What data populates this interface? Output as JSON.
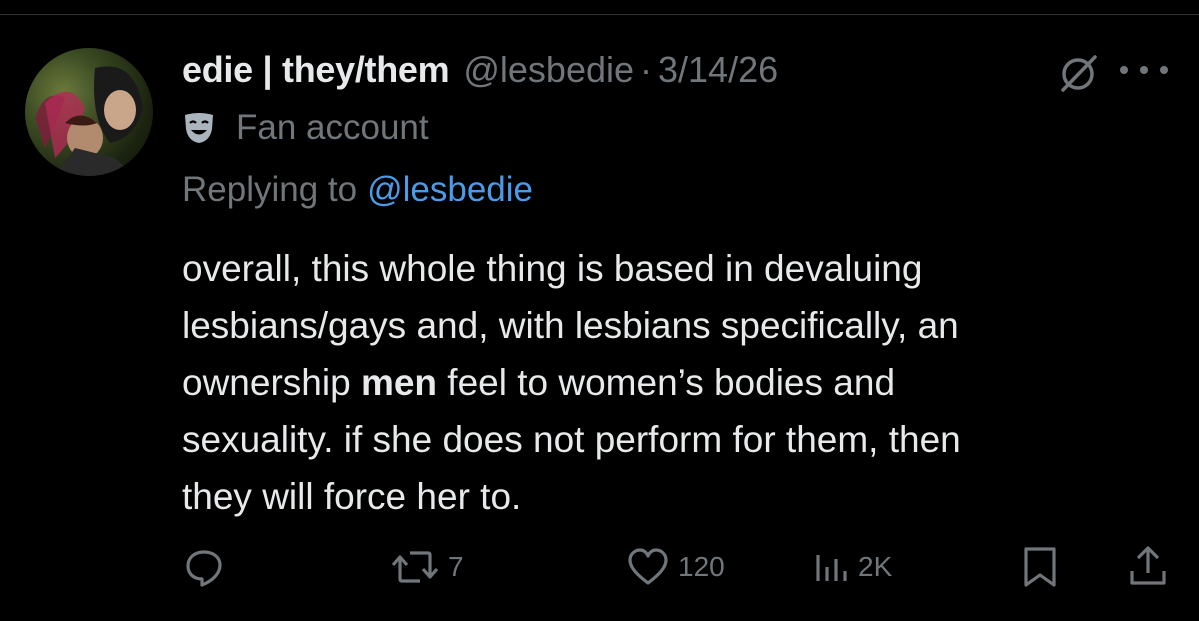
{
  "tweet": {
    "display_name": "edie | they/them",
    "handle": "@lesbedie",
    "separator": "·",
    "date": "3/14/26",
    "account_label": "Fan account",
    "replying_prefix": "Replying to",
    "replying_to": "@lesbedie",
    "body": {
      "line1": "overall, this whole thing is based in devaluing",
      "line2": "lesbians/gays and, with lesbians specifically, an",
      "line3_pre": "ownership ",
      "line3_bold": "men",
      "line3_post": " feel to women’s bodies and",
      "line4": "sexuality. if she does not perform for them, then",
      "line5": "they will force her to."
    }
  },
  "actions": {
    "reply_count": "",
    "repost_count": "7",
    "like_count": "120",
    "views_count": "2K"
  },
  "icons": {
    "grok": "grok-icon",
    "more": "more-icon",
    "label": "theater-mask-icon",
    "reply": "reply-icon",
    "repost": "repost-icon",
    "like": "heart-icon",
    "views": "views-icon",
    "bookmark": "bookmark-icon",
    "share": "share-icon"
  },
  "colors": {
    "background": "#000000",
    "text": "#e7e9ea",
    "muted": "#71767b",
    "link": "#4c9be8"
  }
}
